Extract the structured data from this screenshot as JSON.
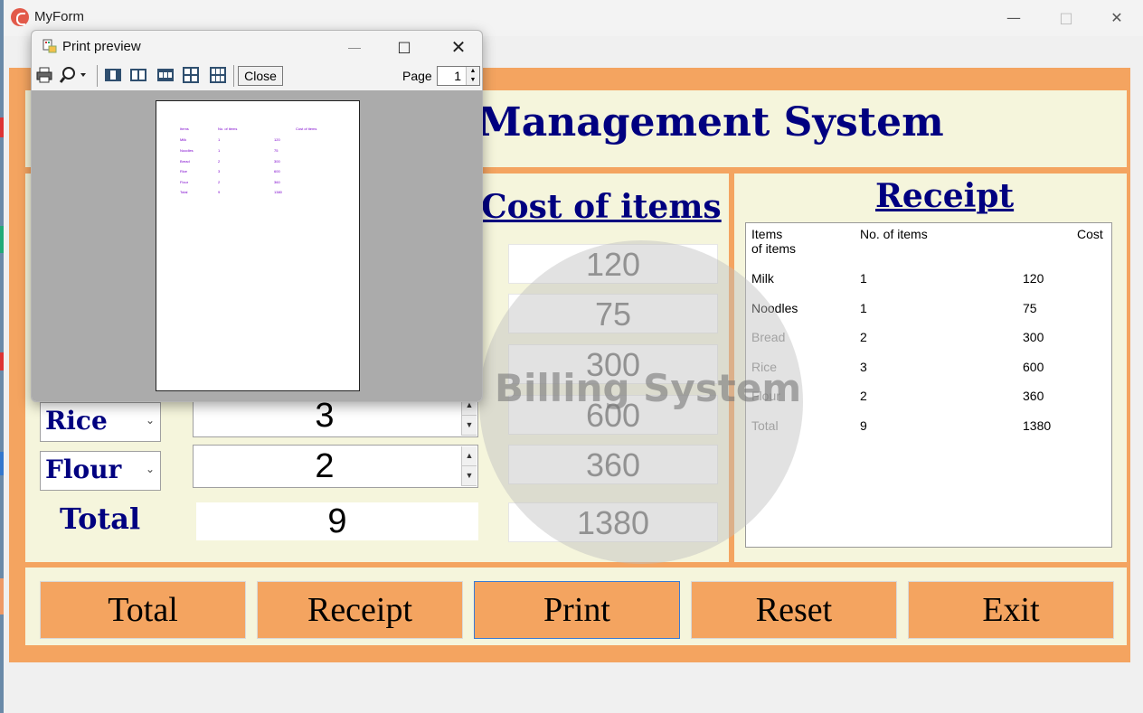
{
  "window": {
    "title": "MyForm"
  },
  "header": {
    "title": "Management System"
  },
  "cost": {
    "title": "Cost of items",
    "values": [
      "120",
      "75",
      "300",
      "600",
      "360"
    ],
    "total": "1380"
  },
  "items": [
    {
      "name": "Rice",
      "qty": "3"
    },
    {
      "name": "Flour",
      "qty": "2"
    }
  ],
  "total": {
    "label": "Total",
    "qty": "9"
  },
  "receipt": {
    "title": "Receipt",
    "headers": {
      "item": "Items\nof items",
      "count": "No. of items",
      "cost": "Cost"
    },
    "rows": [
      {
        "item": "Milk",
        "count": "1",
        "cost": "120"
      },
      {
        "item": "Noodles",
        "count": "1",
        "cost": "75"
      },
      {
        "item": "Bread",
        "count": "2",
        "cost": "300"
      },
      {
        "item": "Rice",
        "count": "3",
        "cost": "600"
      },
      {
        "item": "Flour",
        "count": "2",
        "cost": "360"
      },
      {
        "item": "Total",
        "count": "9",
        "cost": "1380"
      }
    ]
  },
  "buttons": {
    "total": "Total",
    "receipt": "Receipt",
    "print": "Print",
    "reset": "Reset",
    "exit": "Exit"
  },
  "watermark": {
    "text": "Billing System"
  },
  "print_preview": {
    "title": "Print preview",
    "close_label": "Close",
    "page_label": "Page",
    "page_value": "1",
    "doc": {
      "headers": {
        "item": "Items",
        "count": "No. of items",
        "cost": "Cost of items"
      },
      "rows": [
        {
          "item": "Milk",
          "count": "1",
          "cost": "120"
        },
        {
          "item": "Noodles",
          "count": "1",
          "cost": "75"
        },
        {
          "item": "Bread",
          "count": "2",
          "cost": "300"
        },
        {
          "item": "Rice",
          "count": "3",
          "cost": "600"
        },
        {
          "item": "Flour",
          "count": "2",
          "cost": "360"
        },
        {
          "item": "Total",
          "count": "9",
          "cost": "1380"
        }
      ]
    }
  },
  "icons": {
    "app": "app-icon",
    "minimize": "minimize-icon",
    "maximize": "maximize-icon",
    "close": "close-icon",
    "printer": "printer-icon",
    "zoom": "zoom-icon",
    "one_page": "one-page-icon",
    "two_pages": "two-pages-icon",
    "three_pages": "three-pages-icon",
    "four_pages": "four-pages-icon",
    "six_pages": "six-pages-icon"
  },
  "colors": {
    "form_bg": "#f4a460",
    "panel_bg": "#f5f5dc",
    "heading": "#000080",
    "preview_text": "#7b00cc"
  }
}
